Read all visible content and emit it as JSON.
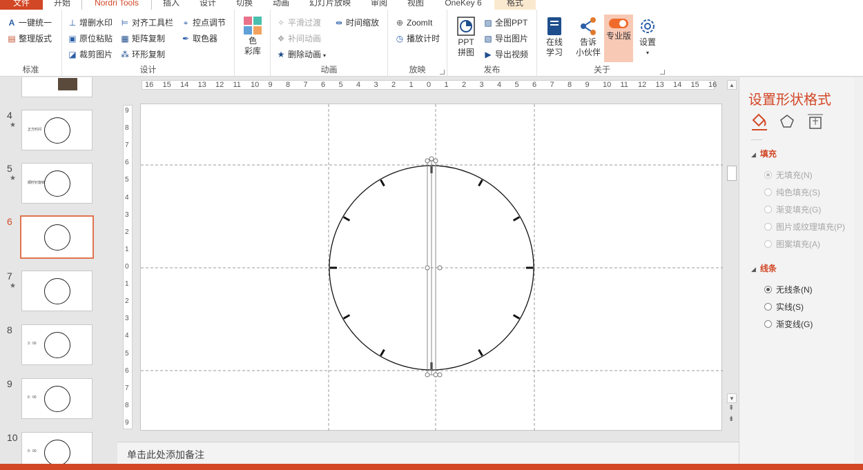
{
  "tabs": [
    "文件",
    "开始",
    "Nordri Tools",
    "插入",
    "设计",
    "切换",
    "动画",
    "幻灯片放映",
    "审阅",
    "视图",
    "OneKey 6",
    "格式"
  ],
  "ribbon": {
    "groups": {
      "standard": "标准",
      "design": "设计",
      "color": "",
      "animation": "动画",
      "play": "放映",
      "publish": "发布",
      "about": "关于"
    },
    "standard": {
      "unify": "一键统一",
      "tidy": "整理版式"
    },
    "design": {
      "watermark": "增删水印",
      "paste_in_place": "原位粘贴",
      "crop_image": "裁剪图片",
      "align_toolbar": "对齐工具栏",
      "matrix_copy": "矩阵复制",
      "ring_copy": "环形复制",
      "point_adjust": "控点调节",
      "color_picker": "取色器"
    },
    "color_lib": "色\n彩库",
    "animation": {
      "smooth": "平滑过渡",
      "tween": "补间动画",
      "delete_anim": "删除动画",
      "time_scale": "时间缩放"
    },
    "play": {
      "zoomit": "ZoomIt",
      "timer": "播放计时"
    },
    "publish": {
      "ppt_stitch": "PPT\n拼图",
      "full_ppt": "全图PPT",
      "export_image": "导出图片",
      "export_video": "导出视频"
    },
    "about": {
      "online_learn": "在线\n学习",
      "tell_friend": "告诉\n小伙伴",
      "pro": "专业版",
      "settings": "设置"
    }
  },
  "thumbnails": [
    {
      "num": "4",
      "star": true,
      "text": "正方时间"
    },
    {
      "num": "5",
      "star": true,
      "text": "顺时针旋转"
    },
    {
      "num": "6",
      "star": false,
      "text": "",
      "selected": true
    },
    {
      "num": "7",
      "star": true,
      "text": ""
    },
    {
      "num": "8",
      "star": false,
      "text": "3 : 00"
    },
    {
      "num": "9",
      "star": false,
      "text": "6 : 00"
    },
    {
      "num": "10",
      "star": false,
      "text": "9 : 00"
    }
  ],
  "ruler": {
    "h": [
      "16",
      "15",
      "14",
      "13",
      "12",
      "11",
      "10",
      "9",
      "8",
      "7",
      "6",
      "5",
      "4",
      "3",
      "2",
      "1",
      "0",
      "1",
      "2",
      "3",
      "4",
      "5",
      "6",
      "7",
      "8",
      "9",
      "10",
      "11",
      "12",
      "13",
      "14",
      "15",
      "16"
    ],
    "v": [
      "9",
      "8",
      "7",
      "6",
      "5",
      "4",
      "3",
      "2",
      "1",
      "0",
      "1",
      "2",
      "3",
      "4",
      "5",
      "6",
      "7",
      "8",
      "9"
    ]
  },
  "notes_placeholder": "单击此处添加备注",
  "format_pane": {
    "title": "设置形状格式",
    "fill_section": "填充",
    "fill_options": [
      "无填充(N)",
      "纯色填充(S)",
      "渐变填充(G)",
      "图片或纹理填充(P)",
      "图案填充(A)"
    ],
    "line_section": "线条",
    "line_options": [
      "无线条(N)",
      "实线(S)",
      "渐变线(G)"
    ]
  },
  "colors": {
    "accent": "#d24726",
    "pro_bg": "#f8c9b5"
  }
}
